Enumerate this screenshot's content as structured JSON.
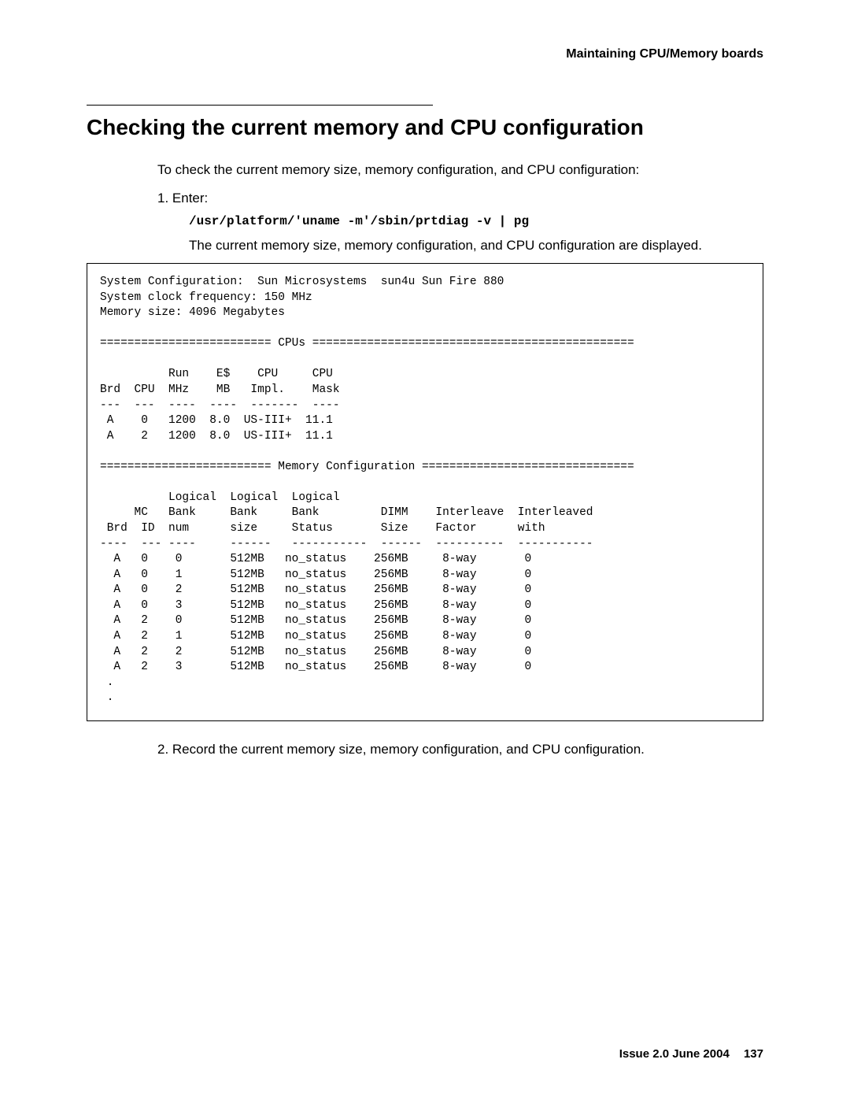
{
  "header": {
    "section": "Maintaining CPU/Memory boards"
  },
  "title": "Checking the current memory and CPU configuration",
  "intro": "To check the current memory size, memory configuration, and CPU configuration:",
  "steps": {
    "step1_label": "1. Enter:",
    "command": "/usr/platform/'uname -m'/sbin/prtdiag -v | pg",
    "result_text": "The current memory size, memory configuration, and CPU configuration are displayed.",
    "step2_text": "2. Record the current memory size, memory configuration, and CPU configuration."
  },
  "terminal": "System Configuration:  Sun Microsystems  sun4u Sun Fire 880\nSystem clock frequency: 150 MHz\nMemory size: 4096 Megabytes\n\n========================= CPUs ===============================================\n\n          Run    E$    CPU     CPU\nBrd  CPU  MHz    MB   Impl.    Mask\n---  ---  ----  ----  -------  ----\n A    0   1200  8.0  US-III+  11.1\n A    2   1200  8.0  US-III+  11.1\n\n========================= Memory Configuration ===============================\n\n          Logical  Logical  Logical\n     MC   Bank     Bank     Bank         DIMM    Interleave  Interleaved\n Brd  ID  num      size     Status       Size    Factor      with\n----  --- ----     ------   -----------  ------  ----------  -----------\n  A   0    0       512MB   no_status    256MB     8-way       0\n  A   0    1       512MB   no_status    256MB     8-way       0\n  A   0    2       512MB   no_status    256MB     8-way       0\n  A   0    3       512MB   no_status    256MB     8-way       0\n  A   2    0       512MB   no_status    256MB     8-way       0\n  A   2    1       512MB   no_status    256MB     8-way       0\n  A   2    2       512MB   no_status    256MB     8-way       0\n  A   2    3       512MB   no_status    256MB     8-way       0\n .\n .",
  "footer": {
    "issue": "Issue 2.0   June 2004",
    "page": "137"
  }
}
